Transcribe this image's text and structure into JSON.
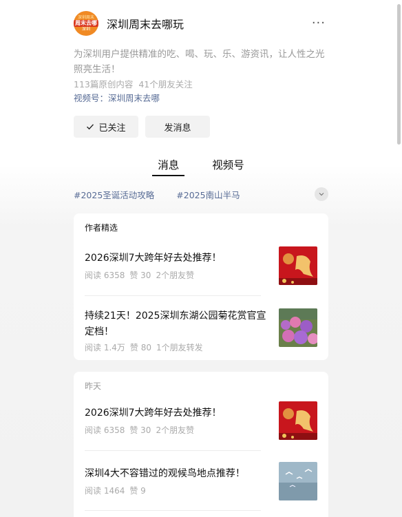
{
  "account": {
    "name": "深圳周末去哪玩",
    "avatar_text_top": "深圳周末",
    "avatar_text_mid": "周末去哪",
    "avatar_text_bottom": "深圳",
    "bio": "为深圳用户提供精准的吃、喝、玩、乐、游资讯，让人性之光照亮生活！",
    "original_count": "113篇原创内容",
    "friends_following": "41个朋友关注",
    "channel": "视频号：深圳周末去哪",
    "follow_label": "已关注",
    "message_label": "发消息"
  },
  "tabs": [
    "消息",
    "视频号"
  ],
  "tags": [
    "#2025圣诞活动攻略",
    "#2025南山半马"
  ],
  "featured": {
    "title": "作者精选",
    "articles": [
      {
        "title": "2026深圳7大跨年好去处推荐！",
        "reads": "阅读 6358",
        "likes": "赞 30",
        "friends": "2个朋友赞"
      },
      {
        "title": "持续21天！2025深圳东湖公园菊花赏官宣定档！",
        "reads": "阅读 1.4万",
        "likes": "赞 80",
        "friends": "1个朋友转发"
      }
    ]
  },
  "yesterday": {
    "title": "昨天",
    "articles": [
      {
        "title": "2026深圳7大跨年好去处推荐！",
        "reads": "阅读 6358",
        "likes": "赞 30",
        "friends": "2个朋友赞"
      },
      {
        "title": "深圳4大不容错过的观候鸟地点推荐！",
        "reads": "阅读 1464",
        "likes": "赞 9",
        "friends": ""
      }
    ]
  },
  "colors": {
    "link": "#576b95",
    "avatar_bg": "#f08a24",
    "muted": "#aaaaaa"
  },
  "icons": [
    "more-icon",
    "check-icon",
    "chevron-down-icon"
  ]
}
